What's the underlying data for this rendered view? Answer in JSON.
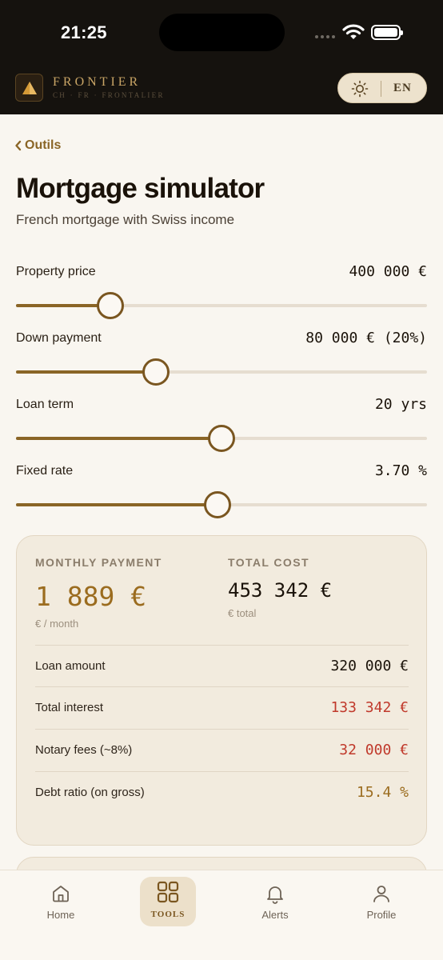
{
  "status": {
    "time": "21:25"
  },
  "brand": {
    "name": "FRONTIER",
    "tagline": "CH · FR · FRONTALIER"
  },
  "header": {
    "language": "EN"
  },
  "page": {
    "back_label": "Outils",
    "title": "Mortgage simulator",
    "subtitle": "French mortgage with Swiss income"
  },
  "sliders": [
    {
      "label": "Property price",
      "value": "400 000 €",
      "level": 0.23
    },
    {
      "label": "Down payment",
      "value": "80 000 € (20%)",
      "level": 0.34
    },
    {
      "label": "Loan term",
      "value": "20 yrs",
      "level": 0.5
    },
    {
      "label": "Fixed rate",
      "value": "3.70 %",
      "level": 0.49
    }
  ],
  "results": {
    "monthly_caption": "MONTHLY PAYMENT",
    "monthly_value": "1 889 €",
    "monthly_unit": "€ / month",
    "total_caption": "TOTAL COST",
    "total_value": "453 342 €",
    "total_unit": "€ total",
    "rows": [
      {
        "label": "Loan amount",
        "value": "320 000 €",
        "color": "#1a1209"
      },
      {
        "label": "Total interest",
        "value": "133 342 €",
        "color": "#c0392b"
      },
      {
        "label": "Notary fees (~8%)",
        "value": "32 000 €",
        "color": "#c0392b"
      },
      {
        "label": "Debt ratio (on gross)",
        "value": "15.4 %",
        "color": "#9b6c1f"
      }
    ]
  },
  "nav": {
    "items": [
      {
        "label": "Home",
        "icon": "home-icon"
      },
      {
        "label": "TOOLS",
        "icon": "grid-icon",
        "active": true
      },
      {
        "label": "Alerts",
        "icon": "bell-icon"
      },
      {
        "label": "Profile",
        "icon": "user-icon"
      }
    ]
  },
  "colors": {
    "accent": "#8a6526",
    "header_bg": "#15120e",
    "page_bg": "#f9f6f0",
    "negative": "#c0392b"
  }
}
